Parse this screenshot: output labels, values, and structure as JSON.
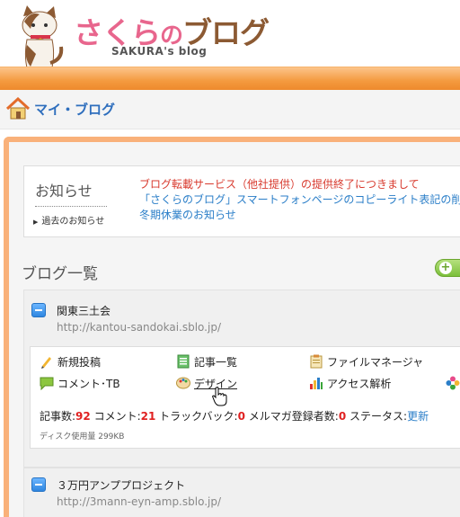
{
  "header": {
    "logo_part1": "さくら",
    "logo_part2": "の",
    "logo_part3": "ブログ",
    "logo_sub": "SAKURA's blog"
  },
  "nav": {
    "my_blog": "マイ・ブログ"
  },
  "notice": {
    "title": "お知らせ",
    "past_link": "過去のお知らせ",
    "items": [
      "ブログ転載サービス（他社提供）の提供終了につきまして",
      "「さくらのブログ」スマートフォンページのコピーライト表記の削",
      "冬期休業のお知らせ"
    ]
  },
  "blog_list": {
    "title": "ブログ一覧",
    "blogs": [
      {
        "name": "関東三土会",
        "url": "http://kantou-sandokai.sblo.jp/",
        "menu": {
          "new_post": "新規投稿",
          "article_list": "記事一覧",
          "file_manager": "ファイルマネージャ",
          "comment_tb": "コメント･TB",
          "design": "デザイン",
          "access": "アクセス解析"
        },
        "stats": {
          "articles_label": "記事数:",
          "articles": "92",
          "comments_label": "コメント:",
          "comments": "21",
          "trackbacks_label": "トラックバック:",
          "trackbacks": "0",
          "mail_label": "メルマガ登録者数:",
          "mail": "0",
          "status_label": "ステータス:",
          "status": "更新"
        },
        "disk": "ディスク使用量 299KB"
      },
      {
        "name": "３万円アンププロジェクト",
        "url": "http://3mann-eyn-amp.sblo.jp/"
      }
    ]
  },
  "colors": {
    "accent_orange": "#f49a3f",
    "link_blue": "#2a7ec8",
    "notice_red": "#d83a2e",
    "stat_red": "#e02020"
  }
}
